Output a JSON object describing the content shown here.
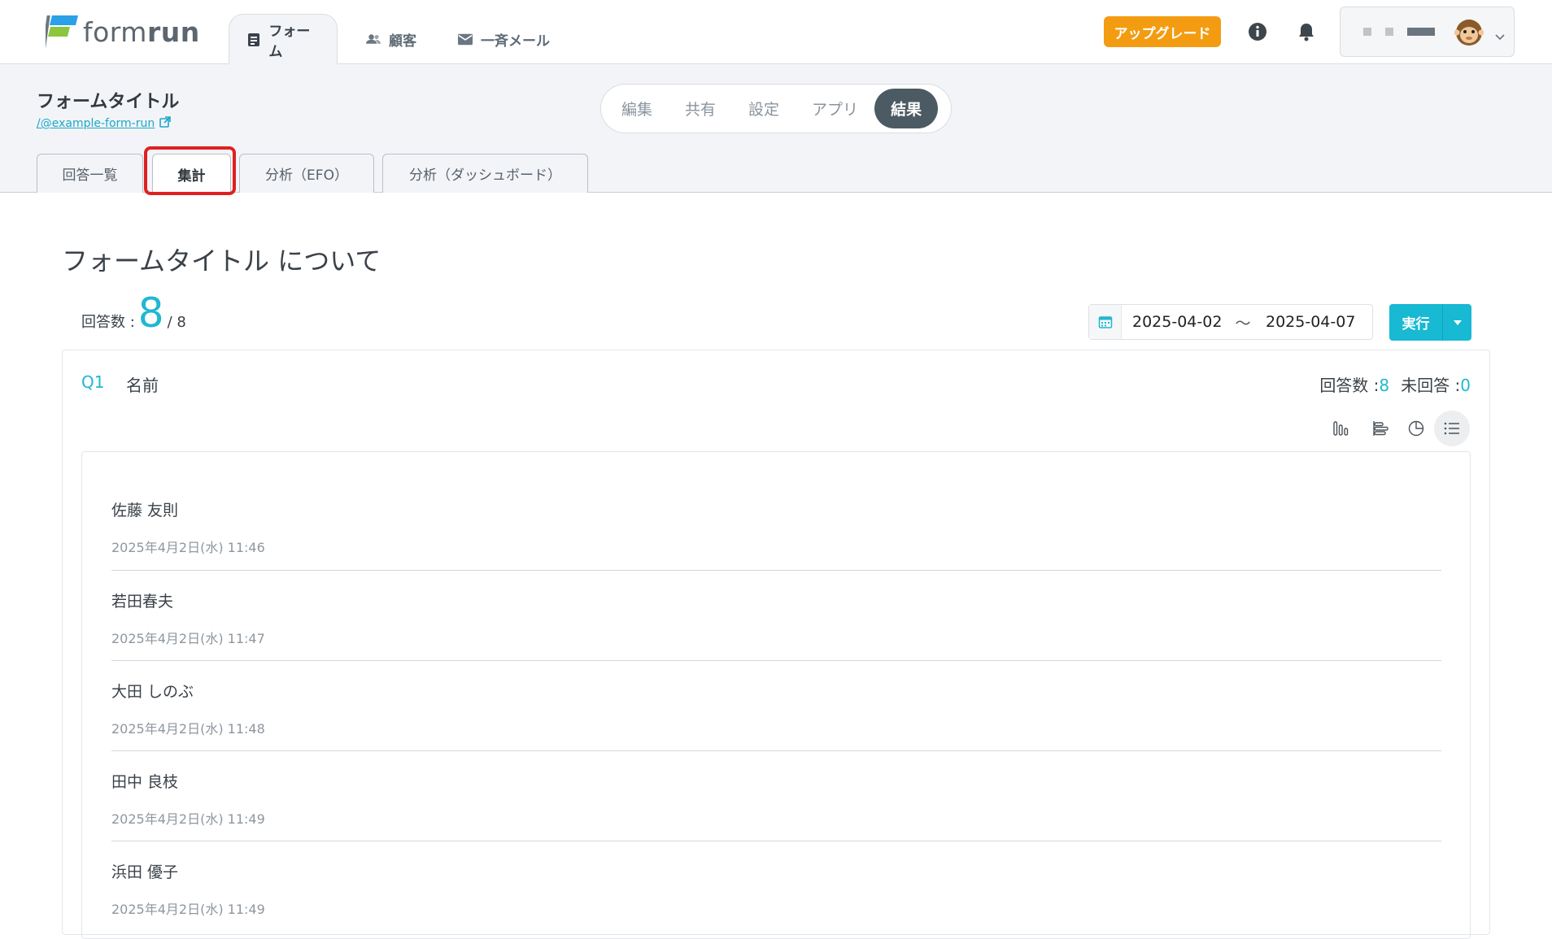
{
  "topbar": {
    "logo_text_light": "form",
    "logo_text_bold": "run",
    "nav": [
      {
        "label": "フォーム",
        "icon": "form-icon"
      },
      {
        "label": "顧客",
        "icon": "users-icon"
      },
      {
        "label": "一斉メール",
        "icon": "mail-icon"
      }
    ],
    "upgrade_label": "アップグレード"
  },
  "form": {
    "title": "フォームタイトル",
    "link": "/@example-form-run"
  },
  "segments": [
    "編集",
    "共有",
    "設定",
    "アプリ",
    "結果"
  ],
  "tabs": [
    "回答一覧",
    "集計",
    "分析（EFO）",
    "分析（ダッシュボード）"
  ],
  "main": {
    "heading": "フォームタイトル について",
    "count_label": "回答数 :",
    "count_value": "8",
    "count_total": "/ 8",
    "date_from": "2025-04-02",
    "date_sep": "〜",
    "date_to": "2025-04-07",
    "run_label": "実行"
  },
  "question": {
    "number": "Q1",
    "title": "名前",
    "answered_label": "回答数 :",
    "answered_value": "8",
    "unanswered_label": "未回答 :",
    "unanswered_value": "0"
  },
  "answers": [
    {
      "name": "佐藤 友則",
      "time": "2025年4月2日(水) 11:46"
    },
    {
      "name": "若田春夫",
      "time": "2025年4月2日(水) 11:47"
    },
    {
      "name": "大田 しのぶ",
      "time": "2025年4月2日(水) 11:48"
    },
    {
      "name": "田中 良枝",
      "time": "2025年4月2日(水) 11:49"
    },
    {
      "name": "浜田 優子",
      "time": "2025年4月2日(水) 11:49"
    }
  ],
  "colors": {
    "accent": "#1fb8d0",
    "upgrade": "#f39c12",
    "highlight": "#e02020",
    "segment_active": "#4b5a63"
  }
}
